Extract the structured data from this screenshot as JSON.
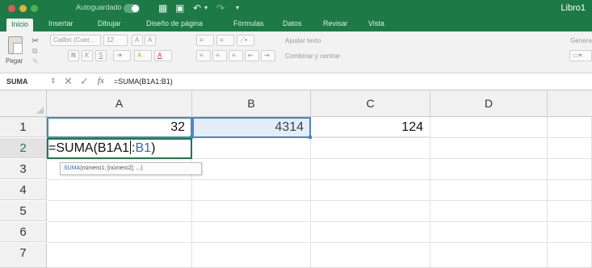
{
  "titlebar": {
    "autosave_label": "Autoguardado",
    "window_title": "Libro1",
    "undo_icon": "undo-icon",
    "redo_icon": "redo-icon"
  },
  "ribbon_tabs": [
    "Inicio",
    "Insertar",
    "Dibujar",
    "Diseño de página",
    "Fórmulas",
    "Datos",
    "Revisar",
    "Vista"
  ],
  "active_tab": "Inicio",
  "clipboard": {
    "paste_label": "Pegar"
  },
  "font": {
    "name": "Calibri (Cuer...",
    "size": "12",
    "grow": "A",
    "shrink": "A",
    "bold": "N",
    "italic": "K",
    "underline": "S",
    "fill": "A",
    "font_color": "A"
  },
  "alignment": {
    "wrap_text": "Ajustar texto",
    "merge_center": "Combinar y centrar"
  },
  "number_format": {
    "label": "Genera"
  },
  "formula_bar": {
    "name_box": "SUMA",
    "fx_label": "fx",
    "formula": "=SUMA(B1A1:B1)"
  },
  "columns": [
    "A",
    "B",
    "C",
    "D"
  ],
  "rows": [
    "1",
    "2",
    "3",
    "4",
    "5",
    "6",
    "7"
  ],
  "cells": {
    "A1": "32",
    "B1": "4314",
    "C1": "124"
  },
  "edit": {
    "prefix": "=SUMA(B1A1",
    "colon": ":",
    "ref": "B1",
    "suffix": ")"
  },
  "tooltip": {
    "fn": "SUMA",
    "args": "(número1; [número2]; ...)"
  },
  "colors": {
    "excel_green": "#1d7a47",
    "reference_blue": "#4a86c5"
  }
}
